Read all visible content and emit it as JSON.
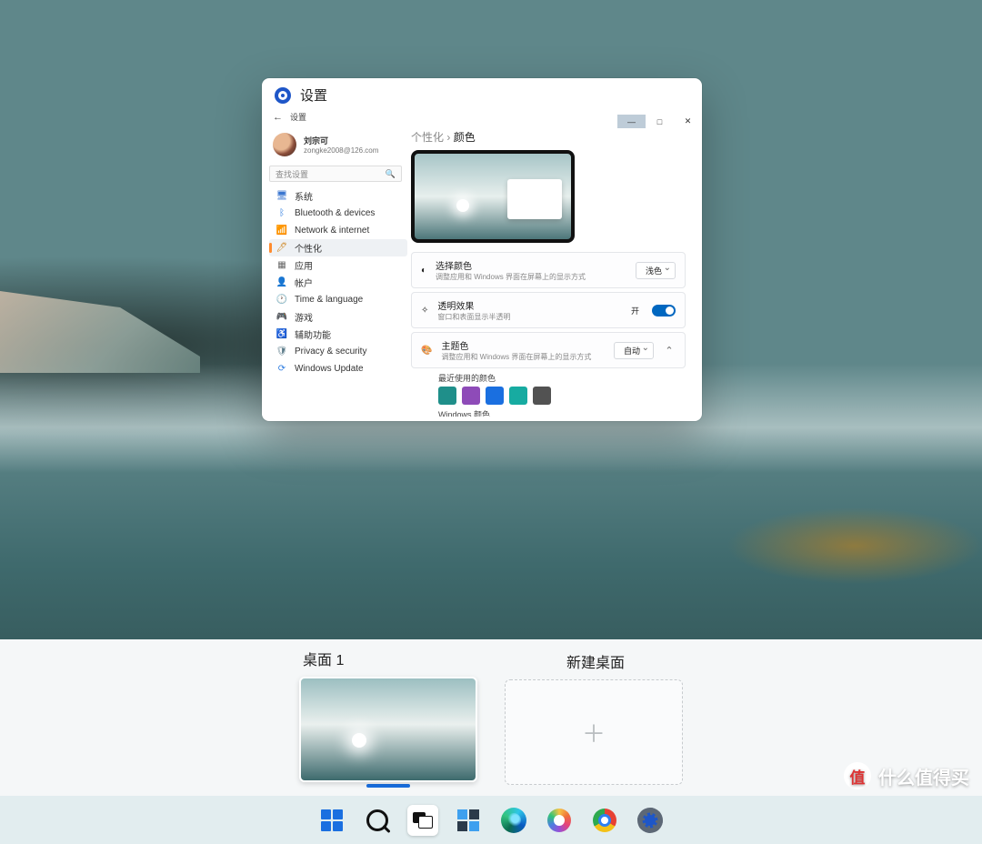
{
  "window": {
    "title": "设置",
    "bar_label": "设置",
    "controls": {
      "min": "—",
      "max": "□",
      "close": "✕"
    }
  },
  "profile": {
    "name": "刘宗可",
    "email": "zongke2008@126.com"
  },
  "search": {
    "placeholder": "查找设置",
    "icon": "🔍"
  },
  "nav": [
    {
      "icon": "🖥",
      "label": "系统",
      "color": "#3a76d0"
    },
    {
      "icon": "ᛒ",
      "label": "Bluetooth & devices",
      "color": "#2f7de0"
    },
    {
      "icon": "📶",
      "label": "Network & internet",
      "color": "#2aa7a0"
    },
    {
      "icon": "🖊",
      "label": "个性化",
      "color": "#d08a2a",
      "active": true
    },
    {
      "icon": "▦",
      "label": "应用",
      "color": "#666"
    },
    {
      "icon": "👤",
      "label": "帐户",
      "color": "#5aa7d0"
    },
    {
      "icon": "🕐",
      "label": "Time & language",
      "color": "#666"
    },
    {
      "icon": "🎮",
      "label": "游戏",
      "color": "#57b36a"
    },
    {
      "icon": "♿",
      "label": "辅助功能",
      "color": "#4a6fb0"
    },
    {
      "icon": "🛡",
      "label": "Privacy & security",
      "color": "#5a7a88"
    },
    {
      "icon": "⟳",
      "label": "Windows Update",
      "color": "#2f7de0"
    }
  ],
  "breadcrumb": {
    "parent": "个性化",
    "sep": "›",
    "current": "颜色"
  },
  "cards": {
    "mode": {
      "icon": "◐",
      "title": "选择颜色",
      "sub": "调整应用和 Windows 界面在屏幕上的显示方式",
      "value": "浅色"
    },
    "transparency": {
      "icon": "✧",
      "title": "透明效果",
      "sub": "窗口和表面显示半透明",
      "state": "开"
    },
    "accent": {
      "icon": "🎨",
      "title": "主题色",
      "sub": "调整应用和 Windows 界面在屏幕上的显示方式",
      "value": "自动"
    }
  },
  "recent_label": "最近使用的颜色",
  "recent_colors": [
    "#1f8f8a",
    "#8e4bb8",
    "#1a6fe0",
    "#17aba1",
    "#525252"
  ],
  "windows_colors_label": "Windows 颜色",
  "windows_colors": [
    "#f2b90f",
    "#e78a0b",
    "#e25d12",
    "#d14a18",
    "#d95a4a",
    "#d0463c",
    "#cf3846",
    "#c73055"
  ],
  "desktops": {
    "d1": "桌面 1",
    "new": "新建桌面"
  },
  "watermark": {
    "badge": "值",
    "text": "什么值得买"
  }
}
